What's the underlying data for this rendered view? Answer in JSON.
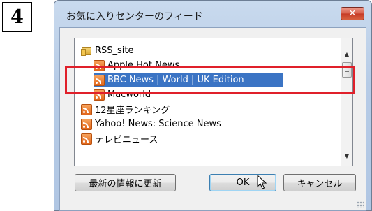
{
  "step": {
    "number": "4"
  },
  "dialog": {
    "title": "お気に入りセンターのフィード",
    "close_glyph": "✕"
  },
  "feeds": {
    "items": [
      {
        "label": "RSS_site",
        "icon": "folder-icon",
        "selected": false
      },
      {
        "label": "Apple Hot News",
        "icon": "rss-feed-icon",
        "selected": false
      },
      {
        "label": "BBC News | World | UK Edition",
        "icon": "rss-feed-icon",
        "selected": true
      },
      {
        "label": "Macworld",
        "icon": "rss-feed-icon",
        "selected": false
      },
      {
        "label": "12星座ランキング",
        "icon": "rss-feed-icon",
        "selected": false
      },
      {
        "label": "Yahoo! News: Science News",
        "icon": "rss-feed-icon",
        "selected": false
      },
      {
        "label": "テレビニュース",
        "icon": "rss-feed-icon",
        "selected": false
      }
    ],
    "scroll_up_glyph": "▲",
    "scroll_down_glyph": "▼"
  },
  "buttons": {
    "update_latest": "最新の情報に更新",
    "ok": "OK",
    "cancel": "キャンセル"
  },
  "colors": {
    "selection": "#3b74c4",
    "highlight_border": "#e0202a",
    "close_button": "#c53a25",
    "rss_orange": "#e2661b"
  }
}
